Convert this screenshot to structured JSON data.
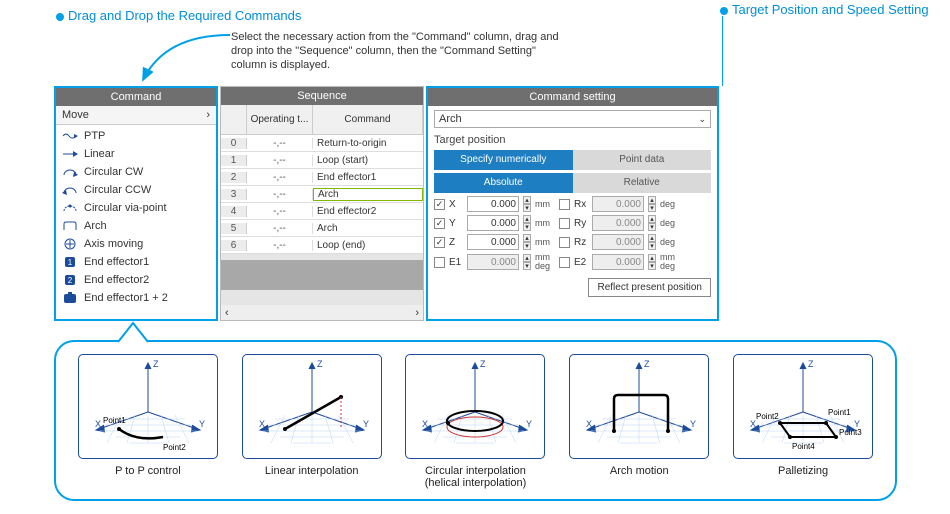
{
  "callouts": {
    "left": "Drag and Drop the Required Commands",
    "right": "Target Position and Speed Setting"
  },
  "instructions": "Select the necessary action from the \"Command\" column, drag and drop into the \"Sequence\" column, then the \"Command Setting\" column is displayed.",
  "command_panel": {
    "title": "Command",
    "group": "Move",
    "items": [
      {
        "icon": "ptp",
        "label": "PTP"
      },
      {
        "icon": "linear",
        "label": "Linear"
      },
      {
        "icon": "cw",
        "label": "Circular CW"
      },
      {
        "icon": "ccw",
        "label": "Circular CCW"
      },
      {
        "icon": "via",
        "label": "Circular via-point"
      },
      {
        "icon": "arch",
        "label": "Arch"
      },
      {
        "icon": "axis",
        "label": "Axis moving"
      },
      {
        "icon": "ee1",
        "label": "End effector1"
      },
      {
        "icon": "ee2",
        "label": "End effector2"
      },
      {
        "icon": "ee12",
        "label": "End effector1 + 2"
      }
    ]
  },
  "sequence_panel": {
    "title": "Sequence",
    "headers": [
      "",
      "Operating t...",
      "Command"
    ],
    "rows": [
      {
        "idx": "0",
        "op": "-,--",
        "cmd": "Return-to-origin"
      },
      {
        "idx": "1",
        "op": "-,--",
        "cmd": "Loop (start)"
      },
      {
        "idx": "2",
        "op": "-,--",
        "cmd": "End effector1"
      },
      {
        "idx": "3",
        "op": "-,--",
        "cmd": "Arch",
        "selected": true
      },
      {
        "idx": "4",
        "op": "-,--",
        "cmd": "End effector2"
      },
      {
        "idx": "5",
        "op": "-,--",
        "cmd": "Arch"
      },
      {
        "idx": "6",
        "op": "-,--",
        "cmd": "Loop (end)"
      }
    ]
  },
  "setting_panel": {
    "title": "Command setting",
    "combo": "Arch",
    "target_label": "Target position",
    "tabs1": {
      "active": "Specify numerically",
      "inactive": "Point data"
    },
    "tabs2": {
      "active": "Absolute",
      "inactive": "Relative"
    },
    "coords": [
      {
        "cb": true,
        "name": "X",
        "val": "0.000",
        "unit": "mm",
        "cb2": false,
        "name2": "Rx",
        "val2": "0.000",
        "unit2": "deg"
      },
      {
        "cb": true,
        "name": "Y",
        "val": "0.000",
        "unit": "mm",
        "cb2": false,
        "name2": "Ry",
        "val2": "0.000",
        "unit2": "deg"
      },
      {
        "cb": true,
        "name": "Z",
        "val": "0.000",
        "unit": "mm",
        "cb2": false,
        "name2": "Rz",
        "val2": "0.000",
        "unit2": "deg"
      },
      {
        "cb": false,
        "name": "E1",
        "val": "0.000",
        "unit": "mm deg",
        "cb2": false,
        "name2": "E2",
        "val2": "0.000",
        "unit2": "mm deg"
      }
    ],
    "reflect_btn": "Reflect present position"
  },
  "diagrams": [
    {
      "label": "P to P control",
      "pt1": "Point1",
      "pt2": "Point2"
    },
    {
      "label": "Linear interpolation"
    },
    {
      "label": "Circular interpolation\n(helical interpolation)"
    },
    {
      "label": "Arch motion"
    },
    {
      "label": "Palletizing",
      "p1": "Point1",
      "p2": "Point2",
      "p3": "Point3",
      "p4": "Point4"
    }
  ],
  "axis": {
    "x": "X",
    "y": "Y",
    "z": "Z"
  }
}
